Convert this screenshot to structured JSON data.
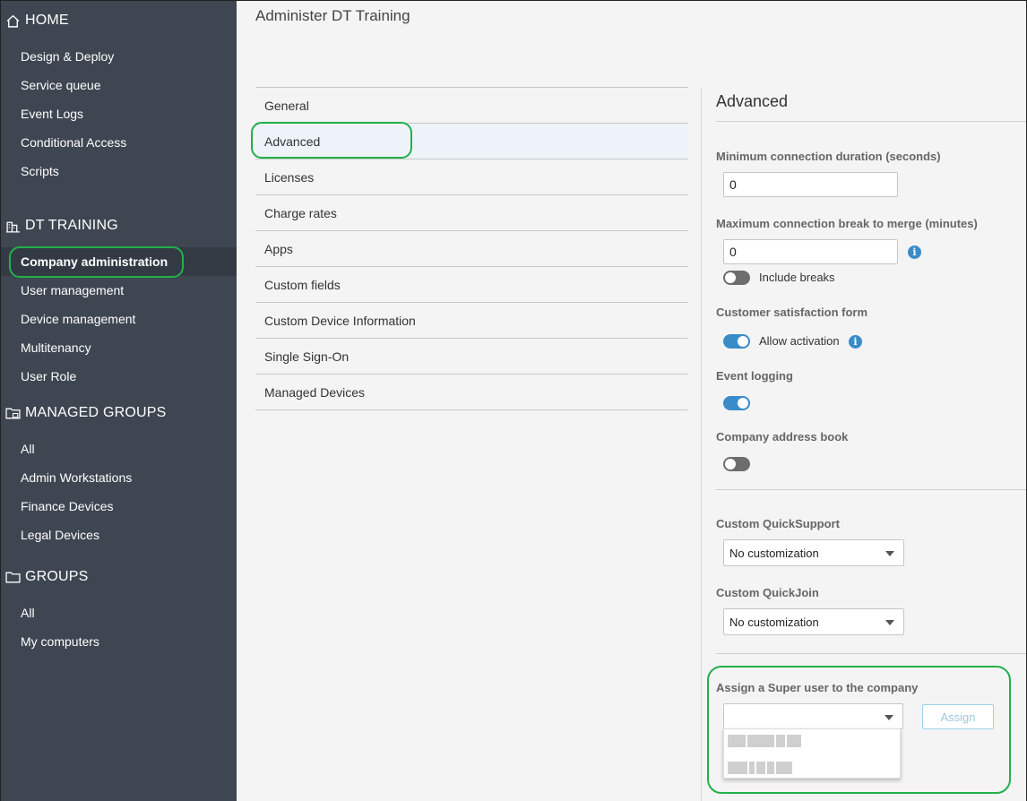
{
  "sidebar": {
    "sections": [
      {
        "title": "HOME",
        "icon": "home-icon",
        "items": [
          "Design & Deploy",
          "Service queue",
          "Event Logs",
          "Conditional Access",
          "Scripts"
        ]
      },
      {
        "title": "DT TRAINING",
        "icon": "building-icon",
        "items": [
          "Company administration",
          "User management",
          "Device management",
          "Multitenancy",
          "User Role"
        ]
      },
      {
        "title": "MANAGED GROUPS",
        "icon": "managed-folder-icon",
        "items": [
          "All",
          "Admin Workstations",
          "Finance Devices",
          "Legal Devices"
        ]
      },
      {
        "title": "GROUPS",
        "icon": "folder-icon",
        "items": [
          "All",
          "My computers"
        ]
      }
    ],
    "active_item": "Company administration"
  },
  "header": {
    "title": "Administer DT Training"
  },
  "menu": {
    "items": [
      "General",
      "Advanced",
      "Licenses",
      "Charge rates",
      "Apps",
      "Custom fields",
      "Custom Device Information",
      "Single Sign-On",
      "Managed Devices"
    ],
    "active": "Advanced"
  },
  "panel": {
    "title": "Advanced",
    "min_duration_label": "Minimum connection duration (seconds)",
    "min_duration_value": "0",
    "max_break_label": "Maximum connection break to merge (minutes)",
    "max_break_value": "0",
    "include_breaks_label": "Include breaks",
    "include_breaks_on": false,
    "satisfaction_label": "Customer satisfaction form",
    "allow_activation_label": "Allow activation",
    "allow_activation_on": true,
    "event_logging_label": "Event logging",
    "event_logging_on": true,
    "address_book_label": "Company address book",
    "address_book_on": false,
    "quicksupport_label": "Custom QuickSupport",
    "quicksupport_value": "No customization",
    "quickjoin_label": "Custom QuickJoin",
    "quickjoin_value": "No customization",
    "super_user_label": "Assign a Super user to the company",
    "super_user_value": "",
    "assign_label": "Assign"
  },
  "colors": {
    "sidebar_bg": "#3e4651",
    "accent": "#3a8cc8",
    "highlight_ring": "#22b04a"
  }
}
